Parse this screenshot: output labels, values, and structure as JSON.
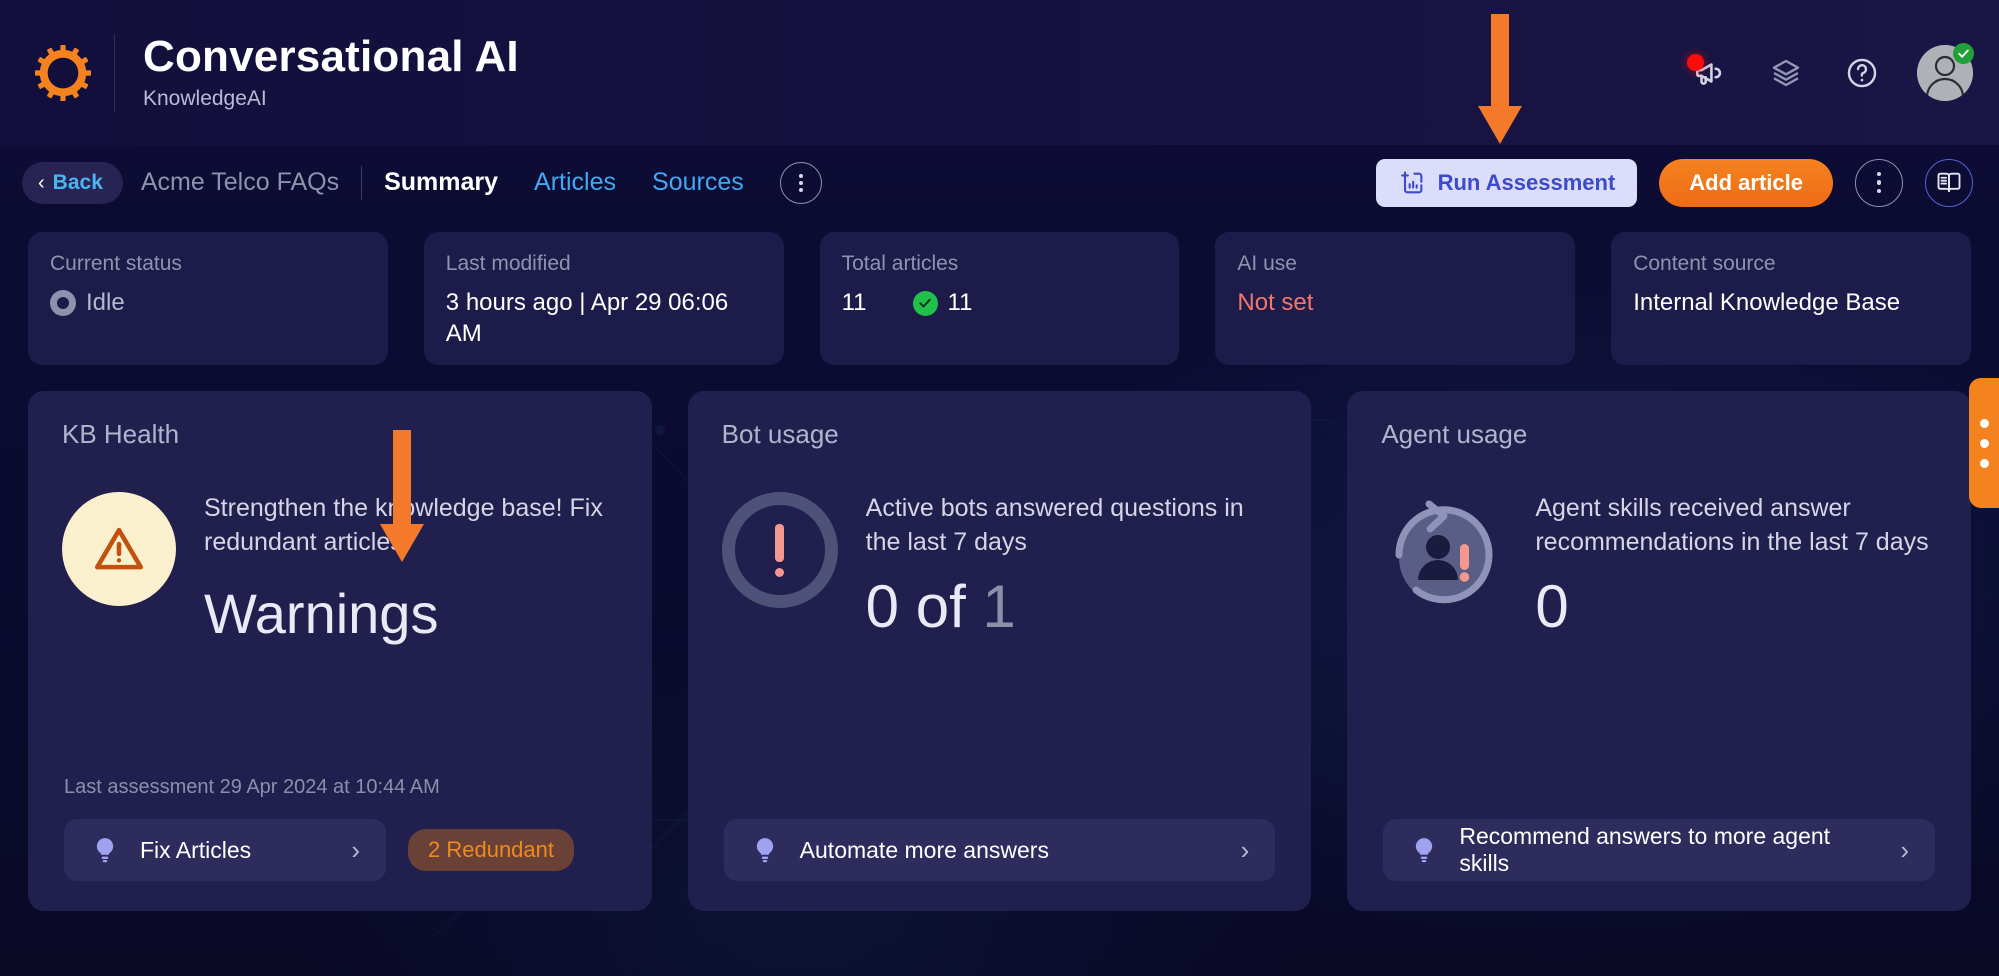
{
  "header": {
    "logo_icon": "gear-icon",
    "title": "Conversational AI",
    "subtitle": "KnowledgeAI",
    "icons": [
      {
        "name": "announcements-icon",
        "glyph": "megaphone",
        "has_badge": true
      },
      {
        "name": "layers-icon",
        "glyph": "layers",
        "has_badge": false
      },
      {
        "name": "help-icon",
        "glyph": "question-circle",
        "has_badge": false
      }
    ],
    "avatar": {
      "name": "user-avatar",
      "status": "online"
    }
  },
  "subnav": {
    "back_label": "Back",
    "kb_name": "Acme Telco FAQs",
    "tabs": [
      {
        "label": "Summary",
        "active": true
      },
      {
        "label": "Articles",
        "active": false
      },
      {
        "label": "Sources",
        "active": false
      }
    ],
    "overflow_icon": "more-vertical-icon",
    "run_assessment_label": "Run Assessment",
    "add_article_label": "Add article",
    "more_icon": "more-vertical-icon",
    "book_icon": "knowledge-book-icon"
  },
  "stats": [
    {
      "label": "Current status",
      "value": "Idle",
      "icon": "idle-spinner-icon",
      "value_color": "#b6b8cd"
    },
    {
      "label": "Last modified",
      "value": "3 hours ago | Apr 29 06:06 AM",
      "icon": null,
      "value_color": "#ffffff"
    },
    {
      "label": "Total articles",
      "value": "11",
      "secondary_value": "11",
      "icon": "green-check-icon",
      "value_color": "#ffffff"
    },
    {
      "label": "AI use",
      "value": "Not set",
      "icon": null,
      "value_color": "#f4766b"
    },
    {
      "label": "Content source",
      "value": "Internal Knowledge Base",
      "icon": null,
      "value_color": "#ffffff"
    }
  ],
  "cards": {
    "kb_health": {
      "title": "KB Health",
      "icon": "warning-triangle-icon",
      "description": "Strengthen the knowledge base! Fix redundant articles.",
      "status_value": "Warnings",
      "last_assessment": "Last assessment 29 Apr 2024 at 10:44 AM",
      "cta_label": "Fix Articles",
      "cta_icon": "lightbulb-icon",
      "cta_chevron": "chevron-right-icon",
      "badge_label": "2 Redundant"
    },
    "bot_usage": {
      "title": "Bot usage",
      "icon": "exclamation-circle-icon",
      "description": "Active bots answered questions in the last 7 days",
      "value": "0 of",
      "value_total": "1",
      "cta_label": "Automate more answers",
      "cta_icon": "lightbulb-icon",
      "cta_chevron": "chevron-right-icon"
    },
    "agent_usage": {
      "title": "Agent usage",
      "icon": "agent-refresh-icon",
      "description": "Agent skills received answer recommendations in the last 7 days",
      "value": "0",
      "cta_label": "Recommend answers to more agent skills",
      "cta_icon": "lightbulb-icon",
      "cta_chevron": "chevron-right-icon"
    }
  },
  "edge_tab": {
    "name": "side-panel-handle",
    "dots": 3
  },
  "annotations": [
    {
      "name": "annotation-arrow-run-assessment",
      "target": "Run Assessment button"
    },
    {
      "name": "annotation-arrow-kb-health",
      "target": "KB Health status"
    }
  ],
  "colors": {
    "accent_orange": "#f4821f",
    "link_blue": "#3fa9f5",
    "danger_red": "#f4766b",
    "success_green": "#21c04a",
    "card_bg": "#211f4d",
    "page_bg": "#0b0b30"
  }
}
